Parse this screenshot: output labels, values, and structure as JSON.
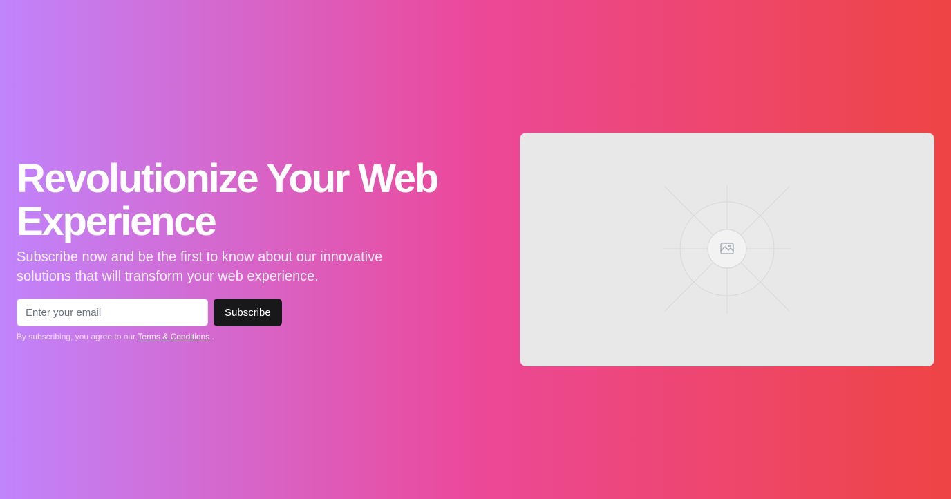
{
  "hero": {
    "title": "Revolutionize Your Web Experience",
    "subtitle": "Subscribe now and be the first to know about our innovative solutions that will transform your web experience.",
    "email_placeholder": "Enter your email",
    "subscribe_label": "Subscribe",
    "disclaimer_prefix": "By subscribing, you agree to our",
    "terms_link": "Terms & Conditions",
    "disclaimer_suffix": "."
  },
  "image_placeholder": {
    "icon": "image-icon"
  },
  "colors": {
    "gradient_start": "#c084fc",
    "gradient_mid": "#ec4899",
    "gradient_end": "#ef4444",
    "button_bg": "#18181b"
  }
}
